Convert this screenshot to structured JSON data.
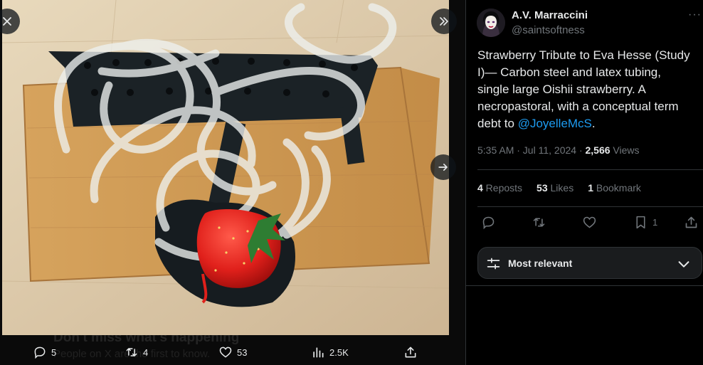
{
  "media": {
    "behind_text_line1": "Don't miss what's happening",
    "behind_text_line2": "People on X are the first to know.",
    "close_label": "Close",
    "collapse_label": "Collapse",
    "next_label": "Next image"
  },
  "media_actions": {
    "replies": "5",
    "reposts": "4",
    "likes": "53",
    "views": "2.5K"
  },
  "author": {
    "name": "A.V. Marraccini",
    "handle": "@saintsoftness"
  },
  "tweet": {
    "text": "Strawberry Tribute to Eva Hesse (Study I)— Carbon steel and latex tubing, single large Oishii strawberry. A necropastoral, with a conceptual term debt to ",
    "mention": "@JoyelleMcS",
    "end": ".",
    "time": "5:35 AM · Jul 11, 2024 · ",
    "views_count": "2,566",
    "views_label": " Views"
  },
  "stats": {
    "reposts_count": "4",
    "reposts_label": " Reposts",
    "likes_count": "53",
    "likes_label": " Likes",
    "bookmarks_count": "1",
    "bookmarks_label": " Bookmark"
  },
  "side_actions": {
    "bookmark_count": "1"
  },
  "sort": {
    "label": "Most relevant"
  },
  "colors": {
    "accent": "#1d9bf0",
    "muted": "#71767b",
    "text": "#e7e9ea",
    "border": "#2f3336"
  }
}
